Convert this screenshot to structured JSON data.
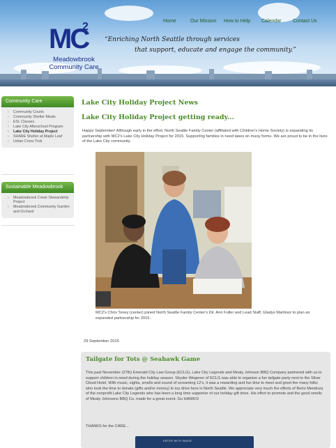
{
  "header": {
    "nav": [
      "Home",
      "Our Mission",
      "How to Help",
      "Calendar",
      "Contact Us"
    ],
    "logo_mark": "MC",
    "logo_sup": "2",
    "logo_line1": "Meadowbrook",
    "logo_line2": "Community Care",
    "tagline_line1": "“Enriching North Seattle through services",
    "tagline_line2": "that support, educate and engage the community.”"
  },
  "sidebar": {
    "community_care": {
      "heading": "Community Care",
      "items": [
        "Community Courts",
        "Community Shelter Meals",
        "ESL Classes",
        "Lake City Afterschool Program",
        "Lake City Holiday Project",
        "SHARE Shelter at Maple Leaf",
        "Urban Cross Trek"
      ],
      "current_index": 4
    },
    "sustainable": {
      "heading": "Sustainable Meadowbrook",
      "items": [
        "Meadowbrook Creek Stewardship Project",
        "Meadowbrook Community Garden and Orchard"
      ]
    }
  },
  "main": {
    "section_title": "Lake City Holiday Project News",
    "article_title": "Lake City Holiday Project getting ready...",
    "intro": "Happy September! Although early in the effort, North Seattle Family Center (affiliated with Children's Home Society) is expanding its partnership with MC2's Lake City Holiday Project for 2015. Supporting families in need takes on many forms. We are proud to be in the lives of the Lake City community.",
    "caption": "MC2's Chris Toney (center) joined North Seattle Family Center's Dir. Ann Fuller and Lead Staff, Gladys Martinez to plan an expanded partnership for 2015.",
    "date": "29 September 2015",
    "post": {
      "title": "Tailgate for Tots @ Seahawk Game",
      "body": "This past November (27th) Emerald City Law Group (ECLG), Lake City Legends and Meaty Johnson BBQ Company partnered with us to support children in need during the holiday season. Stryder Wegener of ECLG was able to organize a fun tailgate party next to the Sliver Cloud Hotel. With music, sights, smells and sound of screaming 12's, it was a rewarding and fun time to meet and greet the many folks who took the time to donate (gifts and/or money) to toy drive here in North Seattle. We appreciate very much the efforts of Berto Mendoza of the nonprofit Lake City Legends who has been a long time supporter of our holiday gift drive. His effort to promote and the good smells of Meaty Johnsons BBQ Co. made for a great event. Go HAWKS!",
      "thanks": "THANKS for the CARE...",
      "image_text": "ENTER WITH IMAGE"
    }
  },
  "colors": {
    "accent_green": "#4a8a2a",
    "sidebar_head": "#4e9a2e",
    "logo_blue": "#1a2f8a"
  }
}
